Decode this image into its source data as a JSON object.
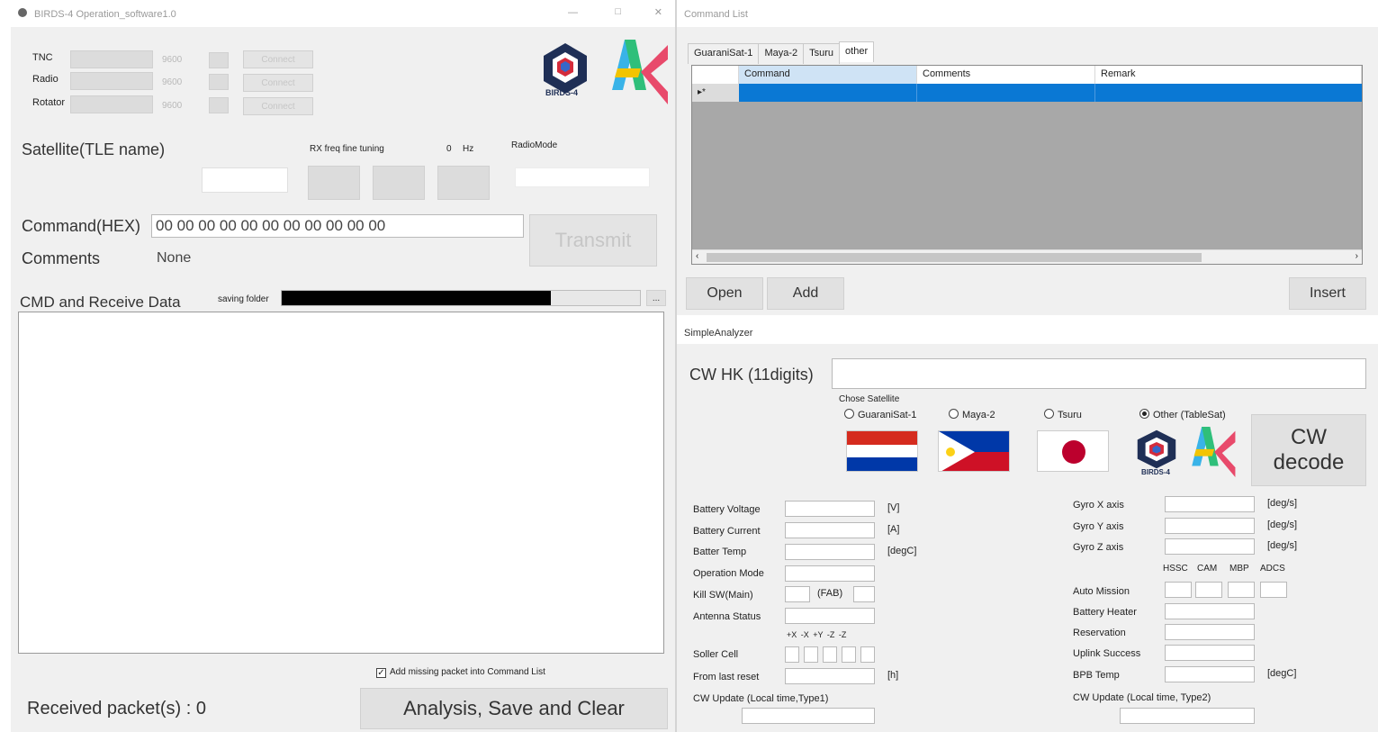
{
  "left_window": {
    "title": "BIRDS-4 Operation_software1.0",
    "ports": [
      {
        "label": "TNC",
        "baud": "9600",
        "button": "Connect"
      },
      {
        "label": "Radio",
        "baud": "9600",
        "button": "Connect"
      },
      {
        "label": "Rotator",
        "baud": "9600",
        "button": "Connect"
      }
    ],
    "satellite_label": "Satellite(TLE name)",
    "rx_fine_tuning_label": "RX freq fine tuning",
    "rx_fine_value": "0",
    "rx_fine_unit": "Hz",
    "radio_mode_label": "RadioMode",
    "command_label": "Command(HEX)",
    "command_value": "00 00 00 00 00 00 00 00 00 00 00",
    "transmit_label": "Transmit",
    "comments_label": "Comments",
    "comments_value": "None",
    "cmd_receive_label": "CMD and Receive Data",
    "saving_folder_label": "saving folder",
    "browse_label": "...",
    "add_missing_label": "Add missing packet into Command List",
    "received_label": "Received packet(s) : 0",
    "analysis_button": "Analysis, Save and Clear",
    "logo_text": "BIRDS-4"
  },
  "command_list": {
    "title": "Command List",
    "tabs": [
      "GuaraniSat-1",
      "Maya-2",
      "Tsuru",
      "other"
    ],
    "columns": [
      "Command",
      "Comments",
      "Remark"
    ],
    "row_marker": "▸*",
    "open_button": "Open",
    "add_button": "Add",
    "insert_button": "Insert"
  },
  "analyzer": {
    "title": "SimpleAnalyzer",
    "cw_hk_label": "CW HK (11digits)",
    "choose_label": "Chose Satellite",
    "satellites": [
      {
        "label": "GuaraniSat-1",
        "selected": false
      },
      {
        "label": "Maya-2",
        "selected": false
      },
      {
        "label": "Tsuru",
        "selected": false
      },
      {
        "label": "Other (TableSat)",
        "selected": true
      }
    ],
    "logo_text": "BIRDS-4",
    "cw_decode_line1": "CW",
    "cw_decode_line2": "decode",
    "left_fields": {
      "battery_voltage": "Battery Voltage",
      "battery_voltage_unit": "[V]",
      "battery_current": "Battery Current",
      "battery_current_unit": "[A]",
      "battery_temp": "Batter Temp",
      "battery_temp_unit": "[degC]",
      "operation_mode": "Operation Mode",
      "kill_sw": "Kill SW(Main)",
      "kill_sw_fab": "(FAB)",
      "antenna_status": "Antenna Status",
      "solar_faces": "+X  -X  +Y  -Z  -Z",
      "solar_cell": "Soller Cell",
      "from_last_reset": "From last reset",
      "from_last_reset_unit": "[h]",
      "cw_update_1": "CW Update (Local time,Type1)"
    },
    "right_fields": {
      "gyro_x": "Gyro X axis",
      "gyro_y": "Gyro Y axis",
      "gyro_z": "Gyro Z axis",
      "gyro_unit": "[deg/s]",
      "mission_headers": [
        "HSSC",
        "CAM",
        "MBP",
        "ADCS"
      ],
      "auto_mission": "Auto Mission",
      "battery_heater": "Battery Heater",
      "reservation": "Reservation",
      "uplink_success": "Uplink Success",
      "bpb_temp": "BPB Temp",
      "bpb_temp_unit": "[degC]",
      "cw_update_2": "CW Update (Local time, Type2)"
    }
  }
}
